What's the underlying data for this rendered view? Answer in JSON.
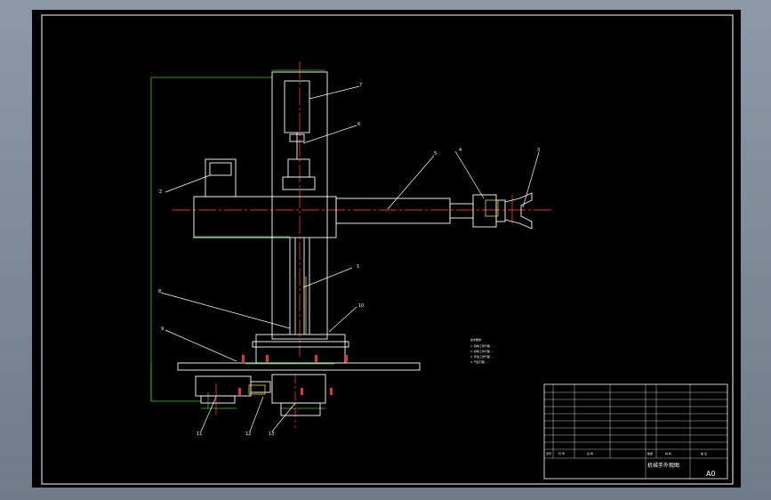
{
  "drawing": {
    "title": "机械手外观图",
    "scale_label": "A0",
    "notes_title": "技术要求：",
    "notes": [
      "1. 机构工作行程 ...",
      "2. 机构工作行程 ...",
      "3. 传动工作行程 ...",
      "4. 气缸行程 ..."
    ],
    "parts_header": [
      "序号",
      "代 号",
      "名 称",
      "数量",
      "材 料",
      "备 注"
    ],
    "callouts": [
      "7",
      "6",
      "5",
      "4",
      "3",
      "2",
      "1",
      "8",
      "9",
      "10",
      "11",
      "12",
      "13"
    ]
  }
}
